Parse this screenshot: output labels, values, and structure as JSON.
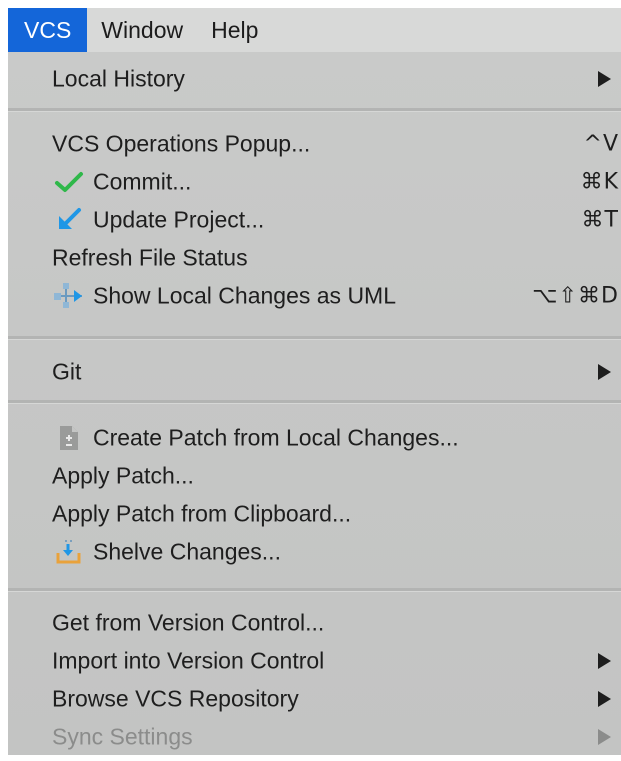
{
  "menubar": {
    "items": [
      {
        "label": "VCS",
        "active": true
      },
      {
        "label": "Window",
        "active": false
      },
      {
        "label": "Help",
        "active": false
      }
    ]
  },
  "menu": {
    "local_history": {
      "label": "Local History",
      "submenu": true
    },
    "vcs_operations_popup": {
      "label": "VCS Operations Popup...",
      "shortcut": "^V"
    },
    "commit": {
      "label": "Commit...",
      "shortcut": "⌘K",
      "icon": "checkmark-icon"
    },
    "update_project": {
      "label": "Update Project...",
      "shortcut": "⌘T",
      "icon": "update-arrow-icon"
    },
    "refresh_file_status": {
      "label": "Refresh File Status"
    },
    "show_local_changes_uml": {
      "label": "Show Local Changes as UML",
      "shortcut": "⌥⇧⌘D",
      "icon": "uml-diagram-icon"
    },
    "git": {
      "label": "Git",
      "submenu": true
    },
    "create_patch": {
      "label": "Create Patch from Local Changes...",
      "icon": "patch-file-icon"
    },
    "apply_patch": {
      "label": "Apply Patch..."
    },
    "apply_patch_clipboard": {
      "label": "Apply Patch from Clipboard..."
    },
    "shelve_changes": {
      "label": "Shelve Changes...",
      "icon": "shelve-icon"
    },
    "get_from_vcs": {
      "label": "Get from Version Control..."
    },
    "import_into_vcs": {
      "label": "Import into Version Control",
      "submenu": true
    },
    "browse_vcs_repo": {
      "label": "Browse VCS Repository",
      "submenu": true
    },
    "sync_settings": {
      "label": "Sync Settings",
      "submenu": true,
      "disabled": true
    }
  },
  "colors": {
    "menubar_bg": "#d8d9d8",
    "active_menu_bg": "#1466d9",
    "panel_bg": "#c6c7c6",
    "checkmark": "#2fb84a",
    "update_arrow": "#1f97e6",
    "disabled_text": "#8b8c8b"
  }
}
